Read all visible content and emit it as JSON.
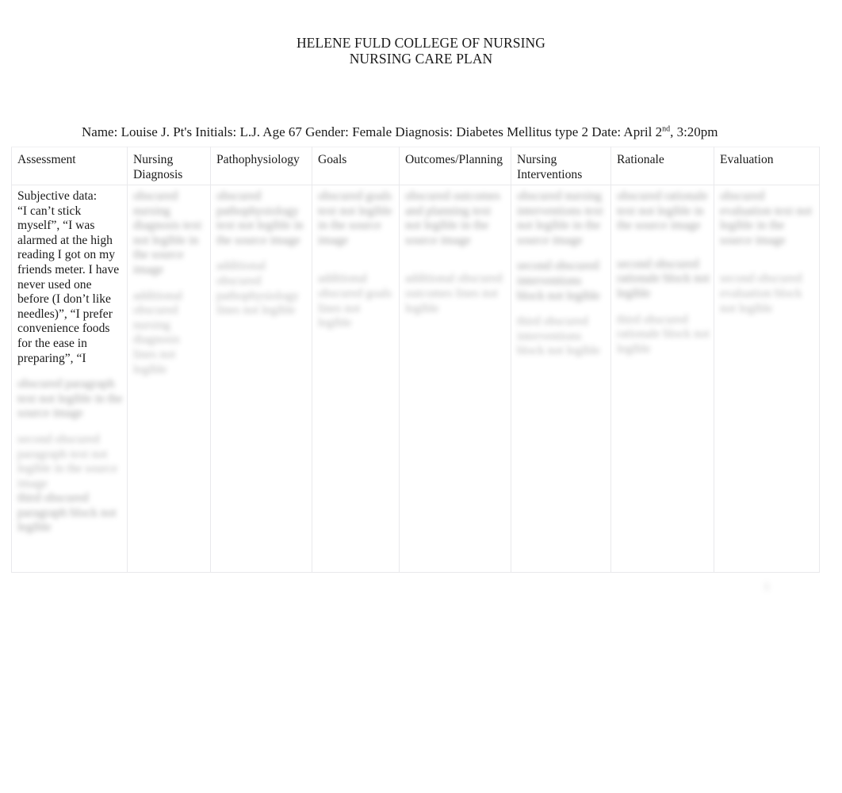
{
  "document": {
    "title_lines": [
      "HELENE FULD COLLEGE OF NURSING",
      "NURSING CARE PLAN"
    ],
    "patient_info": {
      "full_line_prefix": "Name: Louise J.  Pt's Initials:  L.J.  Age 67  Gender: Female Diagnosis: Diabetes Mellitus type 2 Date: April 2",
      "date_ordinal_suffix": "nd",
      "full_line_suffix": ", 3:20pm",
      "name_label": "Name:",
      "name_value": "Louise J.",
      "initials_label": "Pt's Initials:",
      "initials_value": "L.J.",
      "age_label": "Age",
      "age_value": "67",
      "gender_label": "Gender:",
      "gender_value": "Female",
      "diagnosis_label": "Diagnosis:",
      "diagnosis_value": "Diabetes Mellitus type 2",
      "date_label": "Date:",
      "date_value": "April 2nd, 3:20pm"
    },
    "page_mark": "1"
  },
  "table": {
    "headers": [
      "Assessment",
      "Nursing Diagnosis",
      "Pathophysiology",
      "Goals",
      "Outcomes/Planning",
      "Nursing Interventions",
      "Rationale",
      "Evaluation"
    ],
    "row": {
      "assessment": {
        "visible_text": "Subjective data:\n“I can’t stick myself”, “I was alarmed at the high reading I got on my friends meter. I have never used one before (I don’t like needles)”, “I prefer convenience foods for the ease in preparing”, “I",
        "redacted_blocks": [
          "obscured paragraph text not legible in the source image",
          "second obscured paragraph text not legible in the source image",
          "third obscured paragraph block not legible"
        ]
      },
      "nursing_diagnosis": {
        "visible_text": "",
        "redacted_blocks": [
          "obscured nursing diagnosis text not legible in the source image",
          "additional obscured nursing diagnosis lines not legible"
        ]
      },
      "pathophysiology": {
        "visible_text": "",
        "redacted_blocks": [
          "obscured pathophysiology text not legible in the source image",
          "additional obscured pathophysiology lines not legible"
        ]
      },
      "goals": {
        "visible_text": "",
        "redacted_blocks": [
          "obscured goals text not legible in the source image",
          "additional obscured goals lines not legible"
        ]
      },
      "outcomes_planning": {
        "visible_text": "",
        "redacted_blocks": [
          "obscured outcomes and planning text not legible in the source image",
          "additional obscured outcomes lines not legible"
        ]
      },
      "nursing_interventions": {
        "visible_text": "",
        "redacted_blocks": [
          "obscured nursing interventions text not legible in the source image",
          "second obscured interventions block not legible",
          "third obscured interventions block not legible"
        ]
      },
      "rationale": {
        "visible_text": "",
        "redacted_blocks": [
          "obscured rationale text not legible in the source image",
          "second obscured rationale block not legible",
          "third obscured rationale block not legible"
        ]
      },
      "evaluation": {
        "visible_text": "",
        "redacted_blocks": [
          "obscured evaluation text not legible in the source image",
          "second obscured evaluation block not legible"
        ]
      }
    }
  }
}
